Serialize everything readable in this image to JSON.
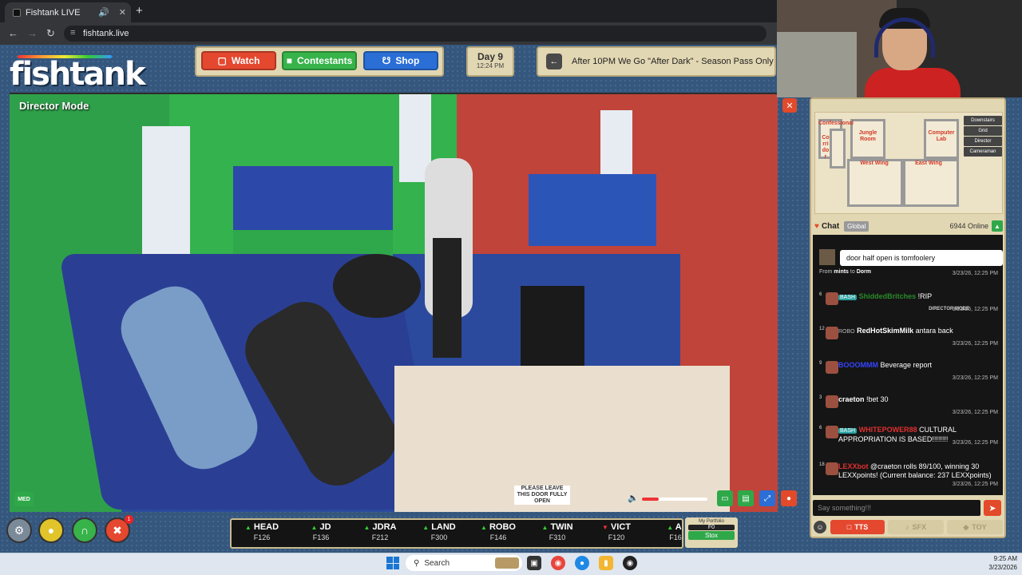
{
  "browser": {
    "tab_title": "Fishtank LIVE",
    "url": "fishtank.live"
  },
  "header": {
    "logo": "fishtank",
    "nav": {
      "watch": "Watch",
      "contestants": "Contestants",
      "shop": "Shop"
    },
    "day": "Day 9",
    "time": "12:24 PM",
    "announcement": "After 10PM We Go \"After Dark\" - Season Pass Only"
  },
  "video": {
    "mode_label": "Director Mode",
    "quality_badge": "MED",
    "volume_level": 0.25,
    "door_sign": "PLEASE LEAVE THIS DOOR FULLY OPEN"
  },
  "map": {
    "rooms": [
      "Confessional",
      "Corridor",
      "Jungle Room",
      "Computer Lab",
      "West Wing",
      "East Wing"
    ],
    "tabs": [
      "Downstairs",
      "Grid",
      "Director",
      "Cameraman"
    ]
  },
  "chat": {
    "title": "Chat",
    "scope": "Global",
    "online": "6944 Online",
    "pinned": {
      "text": "door half open is tomfoolery",
      "from_user": "mints",
      "to_room": "Dorm",
      "timestamp": "3/23/26, 12:25 PM"
    },
    "messages": [
      {
        "level": "6",
        "badge": "BASH",
        "user": "ShiddedBritches",
        "text": "!RIP",
        "timestamp": "3/23/26, 12:25 PM",
        "user_color": "#2a8a2a",
        "note": "DIRECTOR MODE"
      },
      {
        "level": "12",
        "badge": "ROBO",
        "user": "RedHotSkimMilk",
        "text": "antara back",
        "timestamp": "3/23/26, 12:25 PM",
        "user_color": "#ffffff"
      },
      {
        "level": "9",
        "badge": "",
        "user": "BOOOMMM",
        "text": "Beverage report",
        "timestamp": "3/23/26, 12:25 PM",
        "user_color": "#3344ff"
      },
      {
        "level": "3",
        "badge": "",
        "user": "craeton",
        "text": "!bet 30",
        "timestamp": "3/23/26, 12:25 PM",
        "user_color": "#ffffff"
      },
      {
        "level": "6",
        "badge": "BASH",
        "user": "WHITEPOWER88",
        "text": "CULTURAL APPROPRIATION IS BASED!!!!!!!!",
        "timestamp": "3/23/26, 12:25 PM",
        "user_color": "#e03030"
      },
      {
        "level": "18",
        "badge": "",
        "user": "LEXXbot",
        "text": "@craeton rolls 89/100, winning 30 LEXXpoints! (Current balance: 237 LEXXpoints)",
        "timestamp": "3/23/26, 12:25 PM",
        "user_color": "#e03030"
      }
    ],
    "input_placeholder": "Say something!!!",
    "actions": {
      "tts": "TTS",
      "sfx": "SFX",
      "toy": "TOY"
    }
  },
  "ticker": [
    {
      "name": "HEAD",
      "value": "F126",
      "trend": "up"
    },
    {
      "name": "JD",
      "value": "F136",
      "trend": "up"
    },
    {
      "name": "JDRA",
      "value": "F212",
      "trend": "up"
    },
    {
      "name": "LAND",
      "value": "F300",
      "trend": "up"
    },
    {
      "name": "ROBO",
      "value": "F146",
      "trend": "up"
    },
    {
      "name": "TWIN",
      "value": "F310",
      "trend": "up"
    },
    {
      "name": "VICT",
      "value": "F120",
      "trend": "down"
    },
    {
      "name": "AI",
      "value": "F16",
      "trend": "up"
    }
  ],
  "portfolio": {
    "label": "My Portfolio",
    "value": "F0",
    "button": "Stox"
  },
  "bottom_buttons": {
    "notification_count": "1"
  },
  "taskbar": {
    "search": "Search",
    "time": "9:25 AM",
    "date": "3/23/2026"
  },
  "colors": {
    "watch": "#e4482f",
    "contestants": "#37b34a",
    "shop": "#2a6ed6",
    "panel": "#e2d7b3"
  }
}
